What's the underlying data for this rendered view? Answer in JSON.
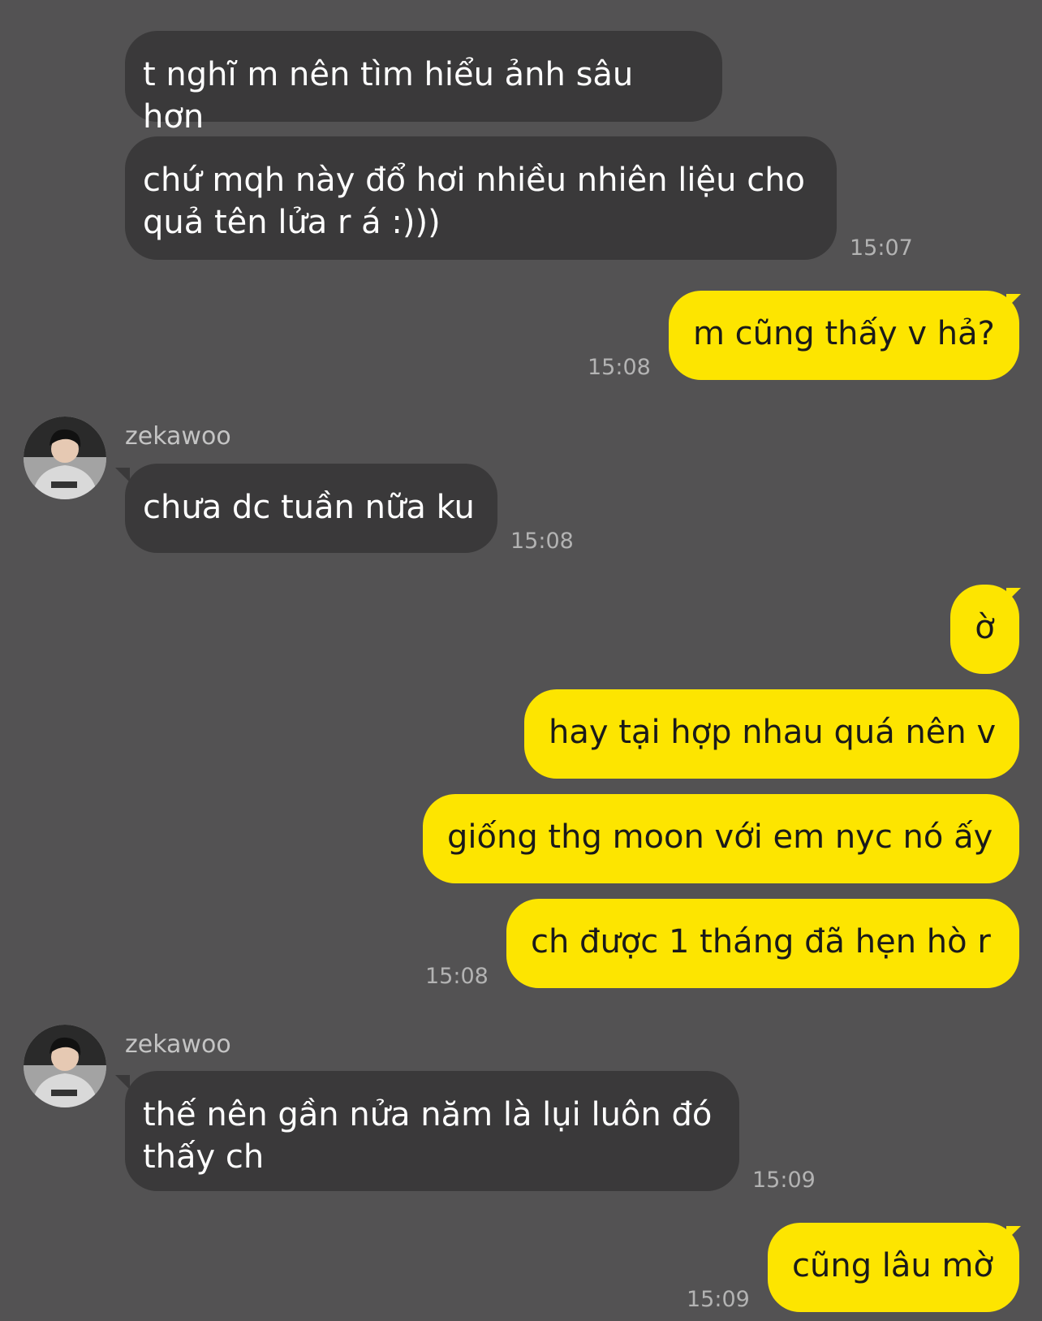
{
  "contact": {
    "name": "zekawoo"
  },
  "messages": [
    {
      "from": "contact",
      "text": "t nghĩ m nên tìm hiểu ảnh sâu hơn"
    },
    {
      "from": "contact",
      "text": "chứ mqh này đổ hơi nhiều nhiên liệu cho\nquả tên lửa r á :)))",
      "time": "15:07"
    },
    {
      "from": "me",
      "text": "m cũng thấy v hả?",
      "time": "15:08"
    },
    {
      "from": "contact",
      "sender": "zekawoo",
      "text": "chưa dc tuần nữa ku",
      "time": "15:08"
    },
    {
      "from": "me",
      "text": "ờ"
    },
    {
      "from": "me",
      "text": "hay tại hợp nhau quá nên v"
    },
    {
      "from": "me",
      "text": "giống thg moon với em nyc nó ấy"
    },
    {
      "from": "me",
      "text": "ch được 1 tháng đã hẹn hò r",
      "time": "15:08"
    },
    {
      "from": "contact",
      "sender": "zekawoo",
      "text": "thế nên gần nửa năm là lụi luôn đó\nthấy ch",
      "time": "15:09"
    },
    {
      "from": "me",
      "text": "cũng lâu mờ",
      "time": "15:09"
    }
  ],
  "colors": {
    "background": "#535253",
    "incoming_bubble": "#3a393a",
    "outgoing_bubble": "#fde500",
    "timestamp": "#b3b3b3"
  }
}
